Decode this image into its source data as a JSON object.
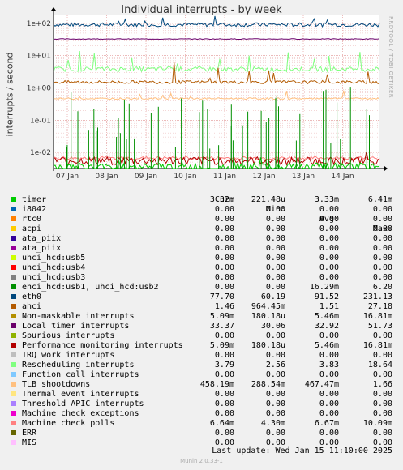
{
  "title": "Individual interrupts - by week",
  "side_text": "RRDTOOL / TOBI OETIKER",
  "footer": "Munin 2.0.33-1",
  "last_update": "Last update:  Wed Jan 15 11:10:00 2025",
  "columns": {
    "cur": "Cur:",
    "min": "Min:",
    "avg": "Avg:",
    "max": "Max:"
  },
  "chart_data": {
    "type": "line",
    "title": "Individual interrupts - by week",
    "ylabel": "interrupts / second",
    "y_scale": "log",
    "y_ticks": [
      "1e-02",
      "1e-01",
      "1e+00",
      "1e+01",
      "1e+02"
    ],
    "x_ticks": [
      "07 Jan",
      "08 Jan",
      "09 Jan",
      "10 Jan",
      "11 Jan",
      "12 Jan",
      "13 Jan",
      "14 Jan"
    ],
    "grid": true,
    "legend_placement": "bottom"
  },
  "legend": [
    {
      "name": "timer",
      "color": "#00cc00",
      "cur": "3.32m",
      "min": "221.48u",
      "avg": "3.33m",
      "max": "6.41m"
    },
    {
      "name": "i8042",
      "color": "#0066b3",
      "cur": "0.00",
      "min": "0.00",
      "avg": "0.00",
      "max": "0.00"
    },
    {
      "name": "rtc0",
      "color": "#ff8000",
      "cur": "0.00",
      "min": "0.00",
      "avg": "0.00",
      "max": "0.00"
    },
    {
      "name": "acpi",
      "color": "#ffcc00",
      "cur": "0.00",
      "min": "0.00",
      "avg": "0.00",
      "max": "0.00"
    },
    {
      "name": "ata_piix",
      "color": "#330099",
      "cur": "0.00",
      "min": "0.00",
      "avg": "0.00",
      "max": "0.00"
    },
    {
      "name": "ata_piix",
      "color": "#990099",
      "cur": "0.00",
      "min": "0.00",
      "avg": "0.00",
      "max": "0.00"
    },
    {
      "name": "uhci_hcd:usb5",
      "color": "#ccff00",
      "cur": "0.00",
      "min": "0.00",
      "avg": "0.00",
      "max": "0.00"
    },
    {
      "name": "uhci_hcd:usb4",
      "color": "#ff0000",
      "cur": "0.00",
      "min": "0.00",
      "avg": "0.00",
      "max": "0.00"
    },
    {
      "name": "uhci_hcd:usb3",
      "color": "#808080",
      "cur": "0.00",
      "min": "0.00",
      "avg": "0.00",
      "max": "0.00"
    },
    {
      "name": "ehci_hcd:usb1, uhci_hcd:usb2",
      "color": "#008f00",
      "cur": "0.00",
      "min": "0.00",
      "avg": "16.29m",
      "max": "6.20"
    },
    {
      "name": "eth0",
      "color": "#00487d",
      "cur": "77.70",
      "min": "60.19",
      "avg": "91.52",
      "max": "231.13"
    },
    {
      "name": "ahci",
      "color": "#b35a00",
      "cur": "1.46",
      "min": "964.45m",
      "avg": "1.51",
      "max": "27.18"
    },
    {
      "name": "Non-maskable interrupts",
      "color": "#b38f00",
      "cur": "5.09m",
      "min": "180.18u",
      "avg": "5.46m",
      "max": "16.81m"
    },
    {
      "name": "Local timer interrupts",
      "color": "#6b006b",
      "cur": "33.37",
      "min": "30.06",
      "avg": "32.92",
      "max": "51.73"
    },
    {
      "name": "Spurious interrupts",
      "color": "#8fb300",
      "cur": "0.00",
      "min": "0.00",
      "avg": "0.00",
      "max": "0.00"
    },
    {
      "name": "Performance monitoring interrupts",
      "color": "#b30000",
      "cur": "5.09m",
      "min": "180.18u",
      "avg": "5.46m",
      "max": "16.81m"
    },
    {
      "name": "IRQ work interrupts",
      "color": "#bebebe",
      "cur": "0.00",
      "min": "0.00",
      "avg": "0.00",
      "max": "0.00"
    },
    {
      "name": "Rescheduling interrupts",
      "color": "#80ff80",
      "cur": "3.79",
      "min": "2.56",
      "avg": "3.83",
      "max": "18.64"
    },
    {
      "name": "Function call interrupts",
      "color": "#80c9ff",
      "cur": "0.00",
      "min": "0.00",
      "avg": "0.00",
      "max": "0.00"
    },
    {
      "name": "TLB shootdowns",
      "color": "#ffc080",
      "cur": "458.19m",
      "min": "288.54m",
      "avg": "467.47m",
      "max": "1.66"
    },
    {
      "name": "Thermal event interrupts",
      "color": "#ffe680",
      "cur": "0.00",
      "min": "0.00",
      "avg": "0.00",
      "max": "0.00"
    },
    {
      "name": "Threshold APIC interrupts",
      "color": "#aa80ff",
      "cur": "0.00",
      "min": "0.00",
      "avg": "0.00",
      "max": "0.00"
    },
    {
      "name": "Machine check exceptions",
      "color": "#ee00cc",
      "cur": "0.00",
      "min": "0.00",
      "avg": "0.00",
      "max": "0.00"
    },
    {
      "name": "Machine check polls",
      "color": "#ff8080",
      "cur": "6.64m",
      "min": "4.30m",
      "avg": "6.67m",
      "max": "10.09m"
    },
    {
      "name": "ERR",
      "color": "#666600",
      "cur": "0.00",
      "min": "0.00",
      "avg": "0.00",
      "max": "0.00"
    },
    {
      "name": "MIS",
      "color": "#ffbfff",
      "cur": "0.00",
      "min": "0.00",
      "avg": "0.00",
      "max": "0.00"
    }
  ]
}
